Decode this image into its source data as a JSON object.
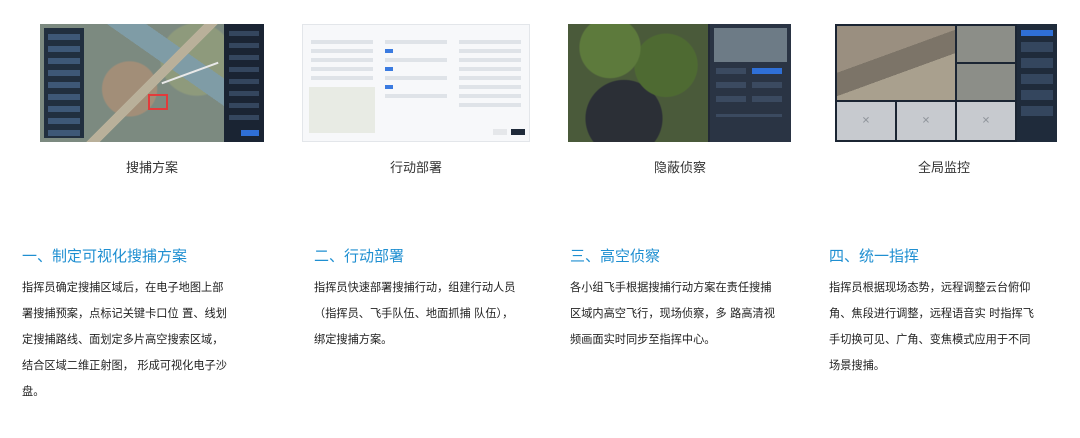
{
  "cards": [
    {
      "caption": "搜捕方案"
    },
    {
      "caption": "行动部署"
    },
    {
      "caption": "隐蔽侦察"
    },
    {
      "caption": "全局监控"
    }
  ],
  "sections": [
    {
      "title": "一、制定可视化搜捕方案",
      "lines": [
        "指挥员确定搜捕区域后，在电子地图上部",
        "署搜捕预案，点标记关键卡口位 置、线划",
        "定搜捕路线、面划定多片高空搜索区域，",
        "结合区域二维正射图， 形成可视化电子沙",
        "盘。"
      ]
    },
    {
      "title": "二、行动部署",
      "lines": [
        "指挥员快速部署搜捕行动，组建行动人员",
        "（指挥员、飞手队伍、地面抓捕 队伍），",
        "绑定搜捕方案。"
      ]
    },
    {
      "title": "三、高空侦察",
      "lines": [
        "各小组飞手根据搜捕行动方案在责任搜捕",
        "区域内高空飞行，现场侦察，多 路高清视",
        "频画面实时同步至指挥中心。"
      ]
    },
    {
      "title": "四、统一指挥",
      "lines": [
        "指挥员根据现场态势，远程调整云台俯仰",
        "角、焦段进行调整，远程语音实 时指挥飞",
        "手切换可见、广角、变焦模式应用于不同",
        "场景搜捕。"
      ]
    }
  ],
  "accent_color": "#1f8fd1"
}
